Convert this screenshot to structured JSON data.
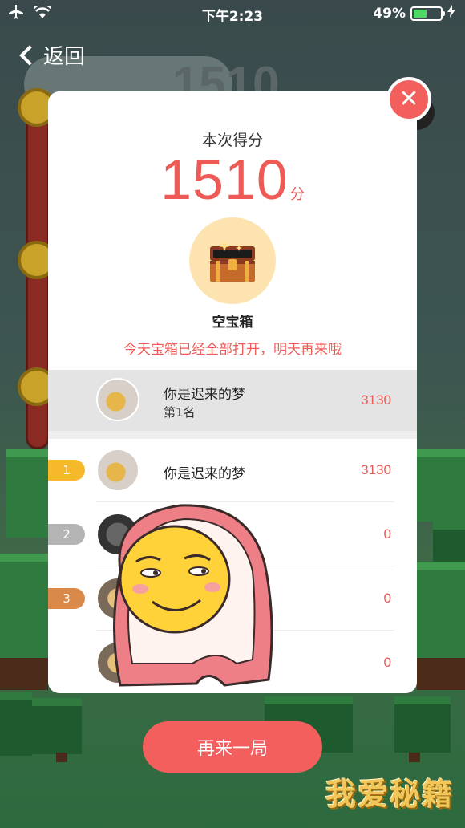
{
  "status_bar": {
    "time": "下午2:23",
    "battery": "49%",
    "battery_level": 0.49
  },
  "nav": {
    "back_label": "返回"
  },
  "background": {
    "score": "1510"
  },
  "modal": {
    "title": "本次得分",
    "score": "1510",
    "score_unit": "分",
    "chest_label": "空宝箱",
    "chest_note": "今天宝箱已经全部打开，明天再来哦",
    "my_rank": {
      "name": "你是迟来的梦",
      "rank_text": "第1名",
      "score": "3130"
    },
    "leaderboard": [
      {
        "rank": "1",
        "name": "你是迟来的梦",
        "score": "3130",
        "badge_color": "#f6b92b"
      },
      {
        "rank": "2",
        "name": "",
        "score": "0",
        "badge_color": "#b4b4b4"
      },
      {
        "rank": "3",
        "name": "",
        "score": "0",
        "badge_color": "#d98a4a"
      },
      {
        "rank": "",
        "name": "猫",
        "score": "0",
        "badge_color": ""
      }
    ]
  },
  "actions": {
    "play_again": "再来一局"
  },
  "watermark": "我爱秘籍",
  "colors": {
    "accent": "#f25f5c",
    "score_red": "#ee5a56"
  },
  "icons": [
    "airplane-icon",
    "wifi-icon",
    "charging-icon",
    "back-chevron-icon",
    "close-icon",
    "treasure-chest-icon"
  ]
}
